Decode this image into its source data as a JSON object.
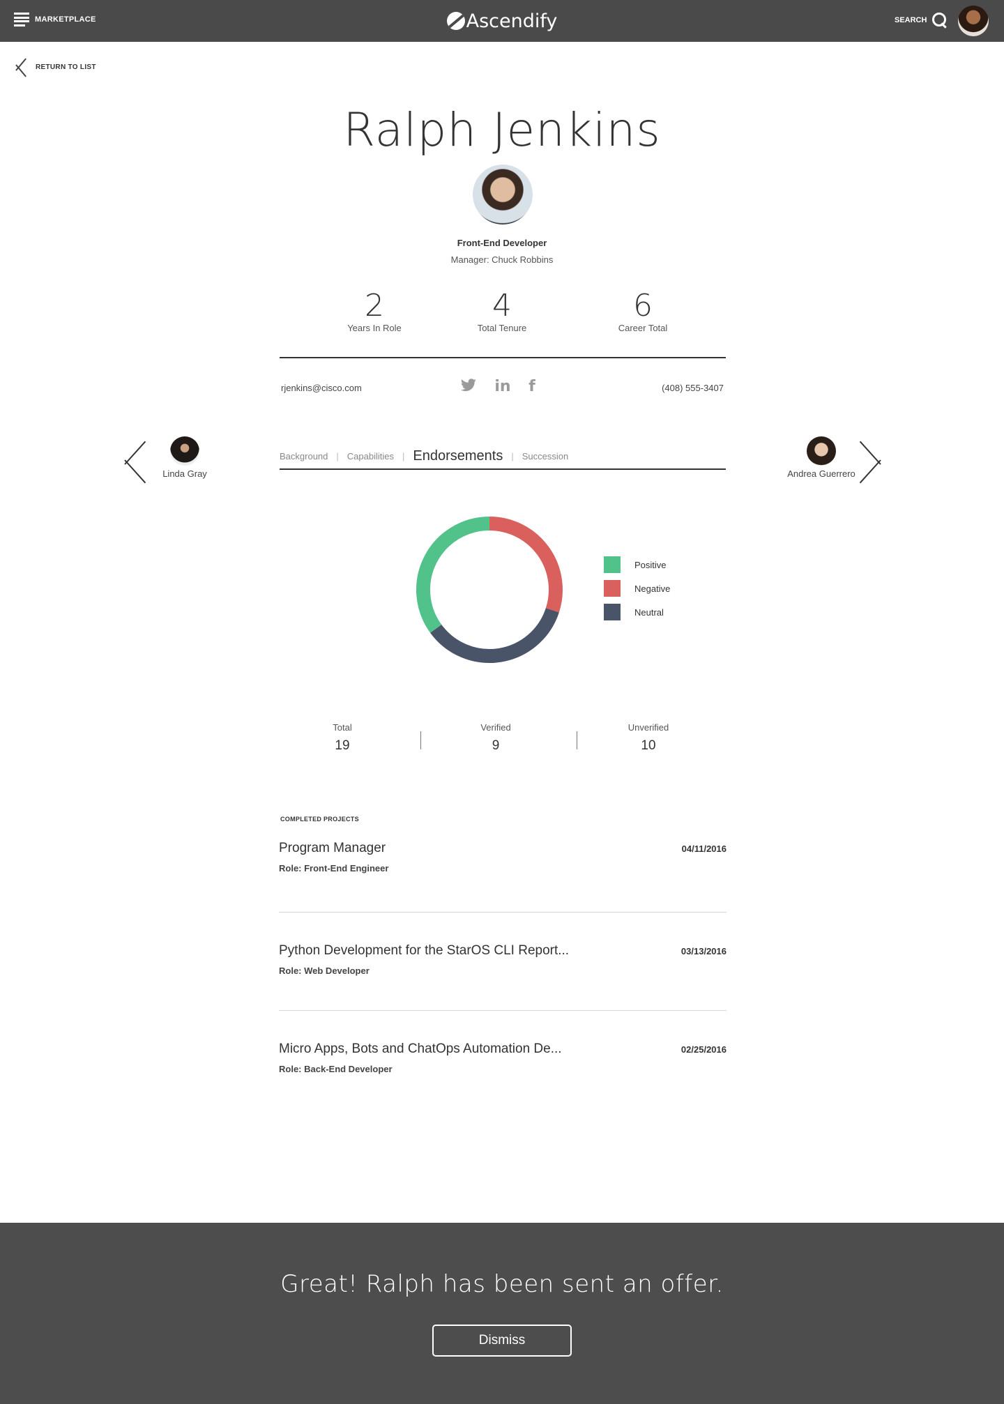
{
  "header": {
    "menu_label": "MARKETPLACE",
    "brand": "Ascendify",
    "search_label": "SEARCH"
  },
  "return_label": "RETURN TO LIST",
  "profile": {
    "name": "Ralph Jenkins",
    "title": "Front-End Developer",
    "manager": "Manager: Chuck Robbins",
    "stats": [
      {
        "value": "2",
        "label": "Years In Role"
      },
      {
        "value": "4",
        "label": "Total Tenure"
      },
      {
        "value": "6",
        "label": "Career Total"
      }
    ],
    "email": "rjenkins@cisco.com",
    "phone": "(408) 555-3407"
  },
  "people_nav": {
    "previous": "Linda Gray",
    "next": "Andrea Guerrero"
  },
  "tabs": [
    {
      "label": "Background",
      "active": false
    },
    {
      "label": "Capabilities",
      "active": false
    },
    {
      "label": "Endorsements",
      "active": true
    },
    {
      "label": "Succession",
      "active": false
    }
  ],
  "chart_data": {
    "type": "pie",
    "style": "donut",
    "categories": [
      "Positive",
      "Negative",
      "Neutral"
    ],
    "values": [
      35,
      30,
      35
    ],
    "colors": [
      "#52c28b",
      "#d9605c",
      "#4a5468"
    ],
    "legend_position": "right"
  },
  "summary": [
    {
      "label": "Total",
      "value": "19"
    },
    {
      "label": "Verified",
      "value": "9"
    },
    {
      "label": "Unverified",
      "value": "10"
    }
  ],
  "projects_heading": "COMPLETED PROJECTS",
  "projects": [
    {
      "title": "Program Manager",
      "role": "Role: Front-End Engineer",
      "date": "04/11/2016"
    },
    {
      "title": "Python Development for the StarOS CLI Report...",
      "role": "Role: Web Developer",
      "date": "03/13/2016"
    },
    {
      "title": "Micro Apps, Bots and ChatOps Automation De...",
      "role": "Role: Back-End Developer",
      "date": "02/25/2016"
    }
  ],
  "banner": {
    "message": "Great! Ralph has been sent an offer.",
    "dismiss_label": "Dismiss"
  },
  "icons": {
    "menu": "hamburger-icon",
    "search": "search-icon",
    "back": "chevron-left-icon",
    "twitter": "twitter-icon",
    "linkedin": "linkedin-icon",
    "facebook": "facebook-icon"
  }
}
